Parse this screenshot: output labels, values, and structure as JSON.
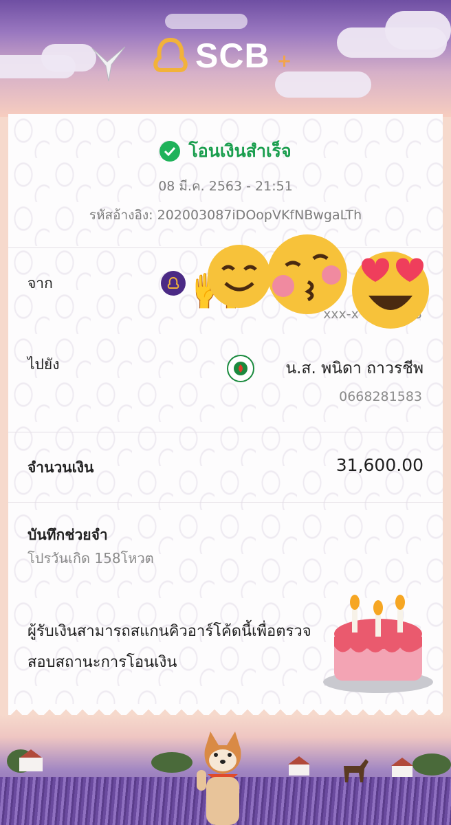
{
  "header": {
    "brand": "SCB",
    "brand_plus": "+"
  },
  "receipt": {
    "status": "โอนเงินสำเร็จ",
    "datetime": "08 มี.ค. 2563 - 21:51",
    "reference_label": "รหัสอ้างอิง:",
    "reference_code": "202003087iDOopVKfNBwgaLTh",
    "from": {
      "label": "จาก",
      "account": "xxx-x",
      "account_tail": "3",
      "bank_icon": "scb-bank-icon"
    },
    "to": {
      "label": "ไปยัง",
      "name": "น.ส. พนิดา ถาวรชีพ",
      "account": "0668281583",
      "bank_icon": "kbank-bank-icon"
    },
    "amount": {
      "label": "จำนวนเงิน",
      "value": "31,600.00"
    },
    "memo": {
      "label": "บันทึกช่วยจำ",
      "text": "โปรวันเกิด 158โหวต"
    },
    "qr_note": "ผู้รับเงินสามารถสแกนคิวอาร์โค้ดนี้เพื่อตรวจสอบสถานะการโอนเงิน"
  },
  "stickers": [
    "raising-hands-emoji",
    "hugging-face-emoji",
    "kissing-face-emoji",
    "heart-eyes-emoji",
    "birthday-cake-emoji"
  ],
  "colors": {
    "brand_purple": "#4b2a85",
    "success_green": "#1fb25a",
    "sky_top": "#6f4fa3",
    "card_bg": "#fdfcfd"
  }
}
